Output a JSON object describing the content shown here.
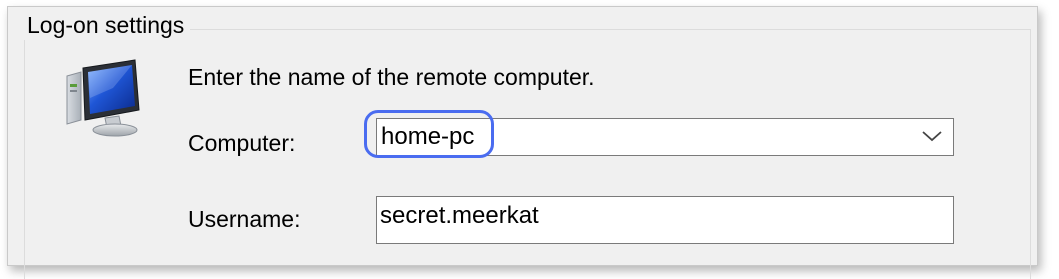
{
  "group": {
    "title": "Log-on settings"
  },
  "prompt": "Enter the name of the remote computer.",
  "computer_field": {
    "label": "Computer:",
    "value": "home-pc",
    "dropdown_icon": "chevron-down-icon"
  },
  "username_field": {
    "label": "Username:",
    "value": "secret.meerkat"
  },
  "icons": {
    "computer": "computer-monitor-icon"
  },
  "colors": {
    "highlight_ring": "#4a6cf0",
    "panel_background": "#f0f0f0",
    "field_border": "#7a7a7a"
  }
}
